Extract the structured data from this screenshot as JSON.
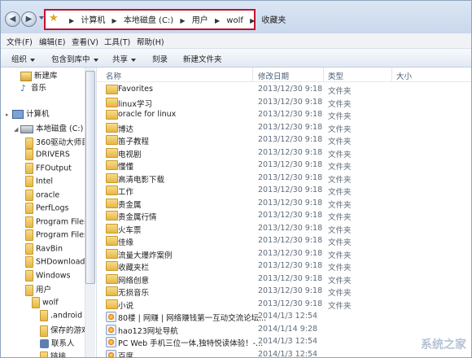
{
  "address_bar": {
    "breadcrumbs": [
      "计算机",
      "本地磁盘 (C:)",
      "用户",
      "wolf",
      "收藏夹"
    ]
  },
  "menu": [
    "文件(F)",
    "编辑(E)",
    "查看(V)",
    "工具(T)",
    "帮助(H)"
  ],
  "toolbar": {
    "organize": "组织",
    "include": "包含到库中",
    "share": "共享",
    "burn": "刻录",
    "new_folder": "新建文件夹"
  },
  "nav": {
    "items": [
      {
        "label": "新建库",
        "icon": "library-icon"
      },
      {
        "label": "音乐",
        "icon": "music-icon"
      },
      {
        "label": "计算机",
        "icon": "computer-icon"
      },
      {
        "label": "本地磁盘 (C:)",
        "icon": "drive-icon"
      },
      {
        "label": "360驱动大师目",
        "icon": "folder-icon"
      },
      {
        "label": "DRIVERS",
        "icon": "folder-icon"
      },
      {
        "label": "FFOutput",
        "icon": "folder-icon"
      },
      {
        "label": "Intel",
        "icon": "folder-icon"
      },
      {
        "label": "oracle",
        "icon": "folder-icon"
      },
      {
        "label": "PerfLogs",
        "icon": "folder-icon"
      },
      {
        "label": "Program Files",
        "icon": "folder-icon"
      },
      {
        "label": "Program Files",
        "icon": "folder-icon"
      },
      {
        "label": "RavBin",
        "icon": "folder-icon"
      },
      {
        "label": "SHDownload",
        "icon": "folder-icon"
      },
      {
        "label": "Windows",
        "icon": "folder-icon"
      },
      {
        "label": "用户",
        "icon": "folder-icon"
      },
      {
        "label": "wolf",
        "icon": "folder-icon"
      },
      {
        "label": ".android",
        "icon": "folder-icon"
      },
      {
        "label": "保存的游戏",
        "icon": "folder-icon"
      },
      {
        "label": "联系人",
        "icon": "contacts-icon"
      },
      {
        "label": "链接",
        "icon": "links-icon"
      }
    ]
  },
  "columns": {
    "name": "名称",
    "date": "修改日期",
    "type": "类型",
    "size": "大小"
  },
  "files": [
    {
      "name": "Favorites",
      "date": "2013/12/30 9:18",
      "type": "文件夹",
      "size": "",
      "icon": "folder"
    },
    {
      "name": "linux学习",
      "date": "2013/12/30 9:18",
      "type": "文件夹",
      "size": "",
      "icon": "folder"
    },
    {
      "name": "oracle for linux",
      "date": "2013/12/30 9:18",
      "type": "文件夹",
      "size": "",
      "icon": "folder"
    },
    {
      "name": "博达",
      "date": "2013/12/30 9:18",
      "type": "文件夹",
      "size": "",
      "icon": "folder"
    },
    {
      "name": "笛子教程",
      "date": "2013/12/30 9:18",
      "type": "文件夹",
      "size": "",
      "icon": "folder"
    },
    {
      "name": "电视剧",
      "date": "2013/12/30 9:18",
      "type": "文件夹",
      "size": "",
      "icon": "folder"
    },
    {
      "name": "懂懂",
      "date": "2013/12/30 9:18",
      "type": "文件夹",
      "size": "",
      "icon": "folder"
    },
    {
      "name": "高清电影下载",
      "date": "2013/12/30 9:18",
      "type": "文件夹",
      "size": "",
      "icon": "folder"
    },
    {
      "name": "工作",
      "date": "2013/12/30 9:18",
      "type": "文件夹",
      "size": "",
      "icon": "folder"
    },
    {
      "name": "贵金属",
      "date": "2013/12/30 9:18",
      "type": "文件夹",
      "size": "",
      "icon": "folder"
    },
    {
      "name": "贵金属行情",
      "date": "2013/12/30 9:18",
      "type": "文件夹",
      "size": "",
      "icon": "folder"
    },
    {
      "name": "火车票",
      "date": "2013/12/30 9:18",
      "type": "文件夹",
      "size": "",
      "icon": "folder"
    },
    {
      "name": "佳缘",
      "date": "2013/12/30 9:18",
      "type": "文件夹",
      "size": "",
      "icon": "folder"
    },
    {
      "name": "流量大爆炸案例",
      "date": "2013/12/30 9:18",
      "type": "文件夹",
      "size": "",
      "icon": "folder"
    },
    {
      "name": "收藏夹栏",
      "date": "2013/12/30 9:18",
      "type": "文件夹",
      "size": "",
      "icon": "folder"
    },
    {
      "name": "网络创意",
      "date": "2013/12/30 9:18",
      "type": "文件夹",
      "size": "",
      "icon": "folder"
    },
    {
      "name": "无损音乐",
      "date": "2013/12/30 9:18",
      "type": "文件夹",
      "size": "",
      "icon": "folder"
    },
    {
      "name": "小说",
      "date": "2013/12/30 9:18",
      "type": "文件夹",
      "size": "",
      "icon": "folder"
    },
    {
      "name": "80楼 | 网赚 | 网络赚钱第一互动交流论坛...",
      "date": "2014/1/3 12:54",
      "type": "",
      "size": "",
      "icon": "web"
    },
    {
      "name": "hao123网址导航",
      "date": "2014/1/14 9:28",
      "type": "",
      "size": "",
      "icon": "web"
    },
    {
      "name": "PC Web 手机三位一体,独特悦读体验！-...",
      "date": "2014/1/3 12:54",
      "type": "",
      "size": "",
      "icon": "web"
    },
    {
      "name": "百度",
      "date": "2014/1/3 12:54",
      "type": "",
      "size": "",
      "icon": "web"
    }
  ],
  "watermark": "系统之家"
}
